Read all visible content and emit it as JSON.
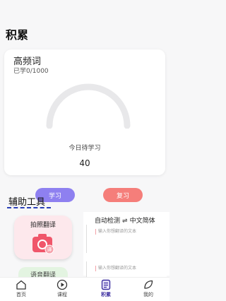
{
  "page": {
    "title": "积累"
  },
  "study_card": {
    "title": "高频词",
    "progress_text": "已学0/1000",
    "gauge_label": "今日待学习",
    "gauge_value": "40",
    "study_button": "学习",
    "review_button": "复习"
  },
  "tools": {
    "title": "辅助工具",
    "photo_translate_label": "拍照翻译",
    "voice_translate_label": "语音翻译"
  },
  "translate": {
    "source_lang": "自动检测",
    "swap_symbol": "⇌",
    "target_lang": "中文简体",
    "placeholder_1": "输入你想翻译的文本",
    "placeholder_2": "输入你想翻译的文本"
  },
  "tabbar": {
    "items": [
      {
        "label": "首页",
        "icon": "home-icon"
      },
      {
        "label": "课程",
        "icon": "play-icon"
      },
      {
        "label": "积累",
        "icon": "notebook-icon",
        "active": true
      },
      {
        "label": "我的",
        "icon": "leaf-icon"
      }
    ]
  },
  "colors": {
    "accent": "#8e80f0",
    "review": "#f57e7a",
    "active_tab": "#3d2fa0"
  }
}
